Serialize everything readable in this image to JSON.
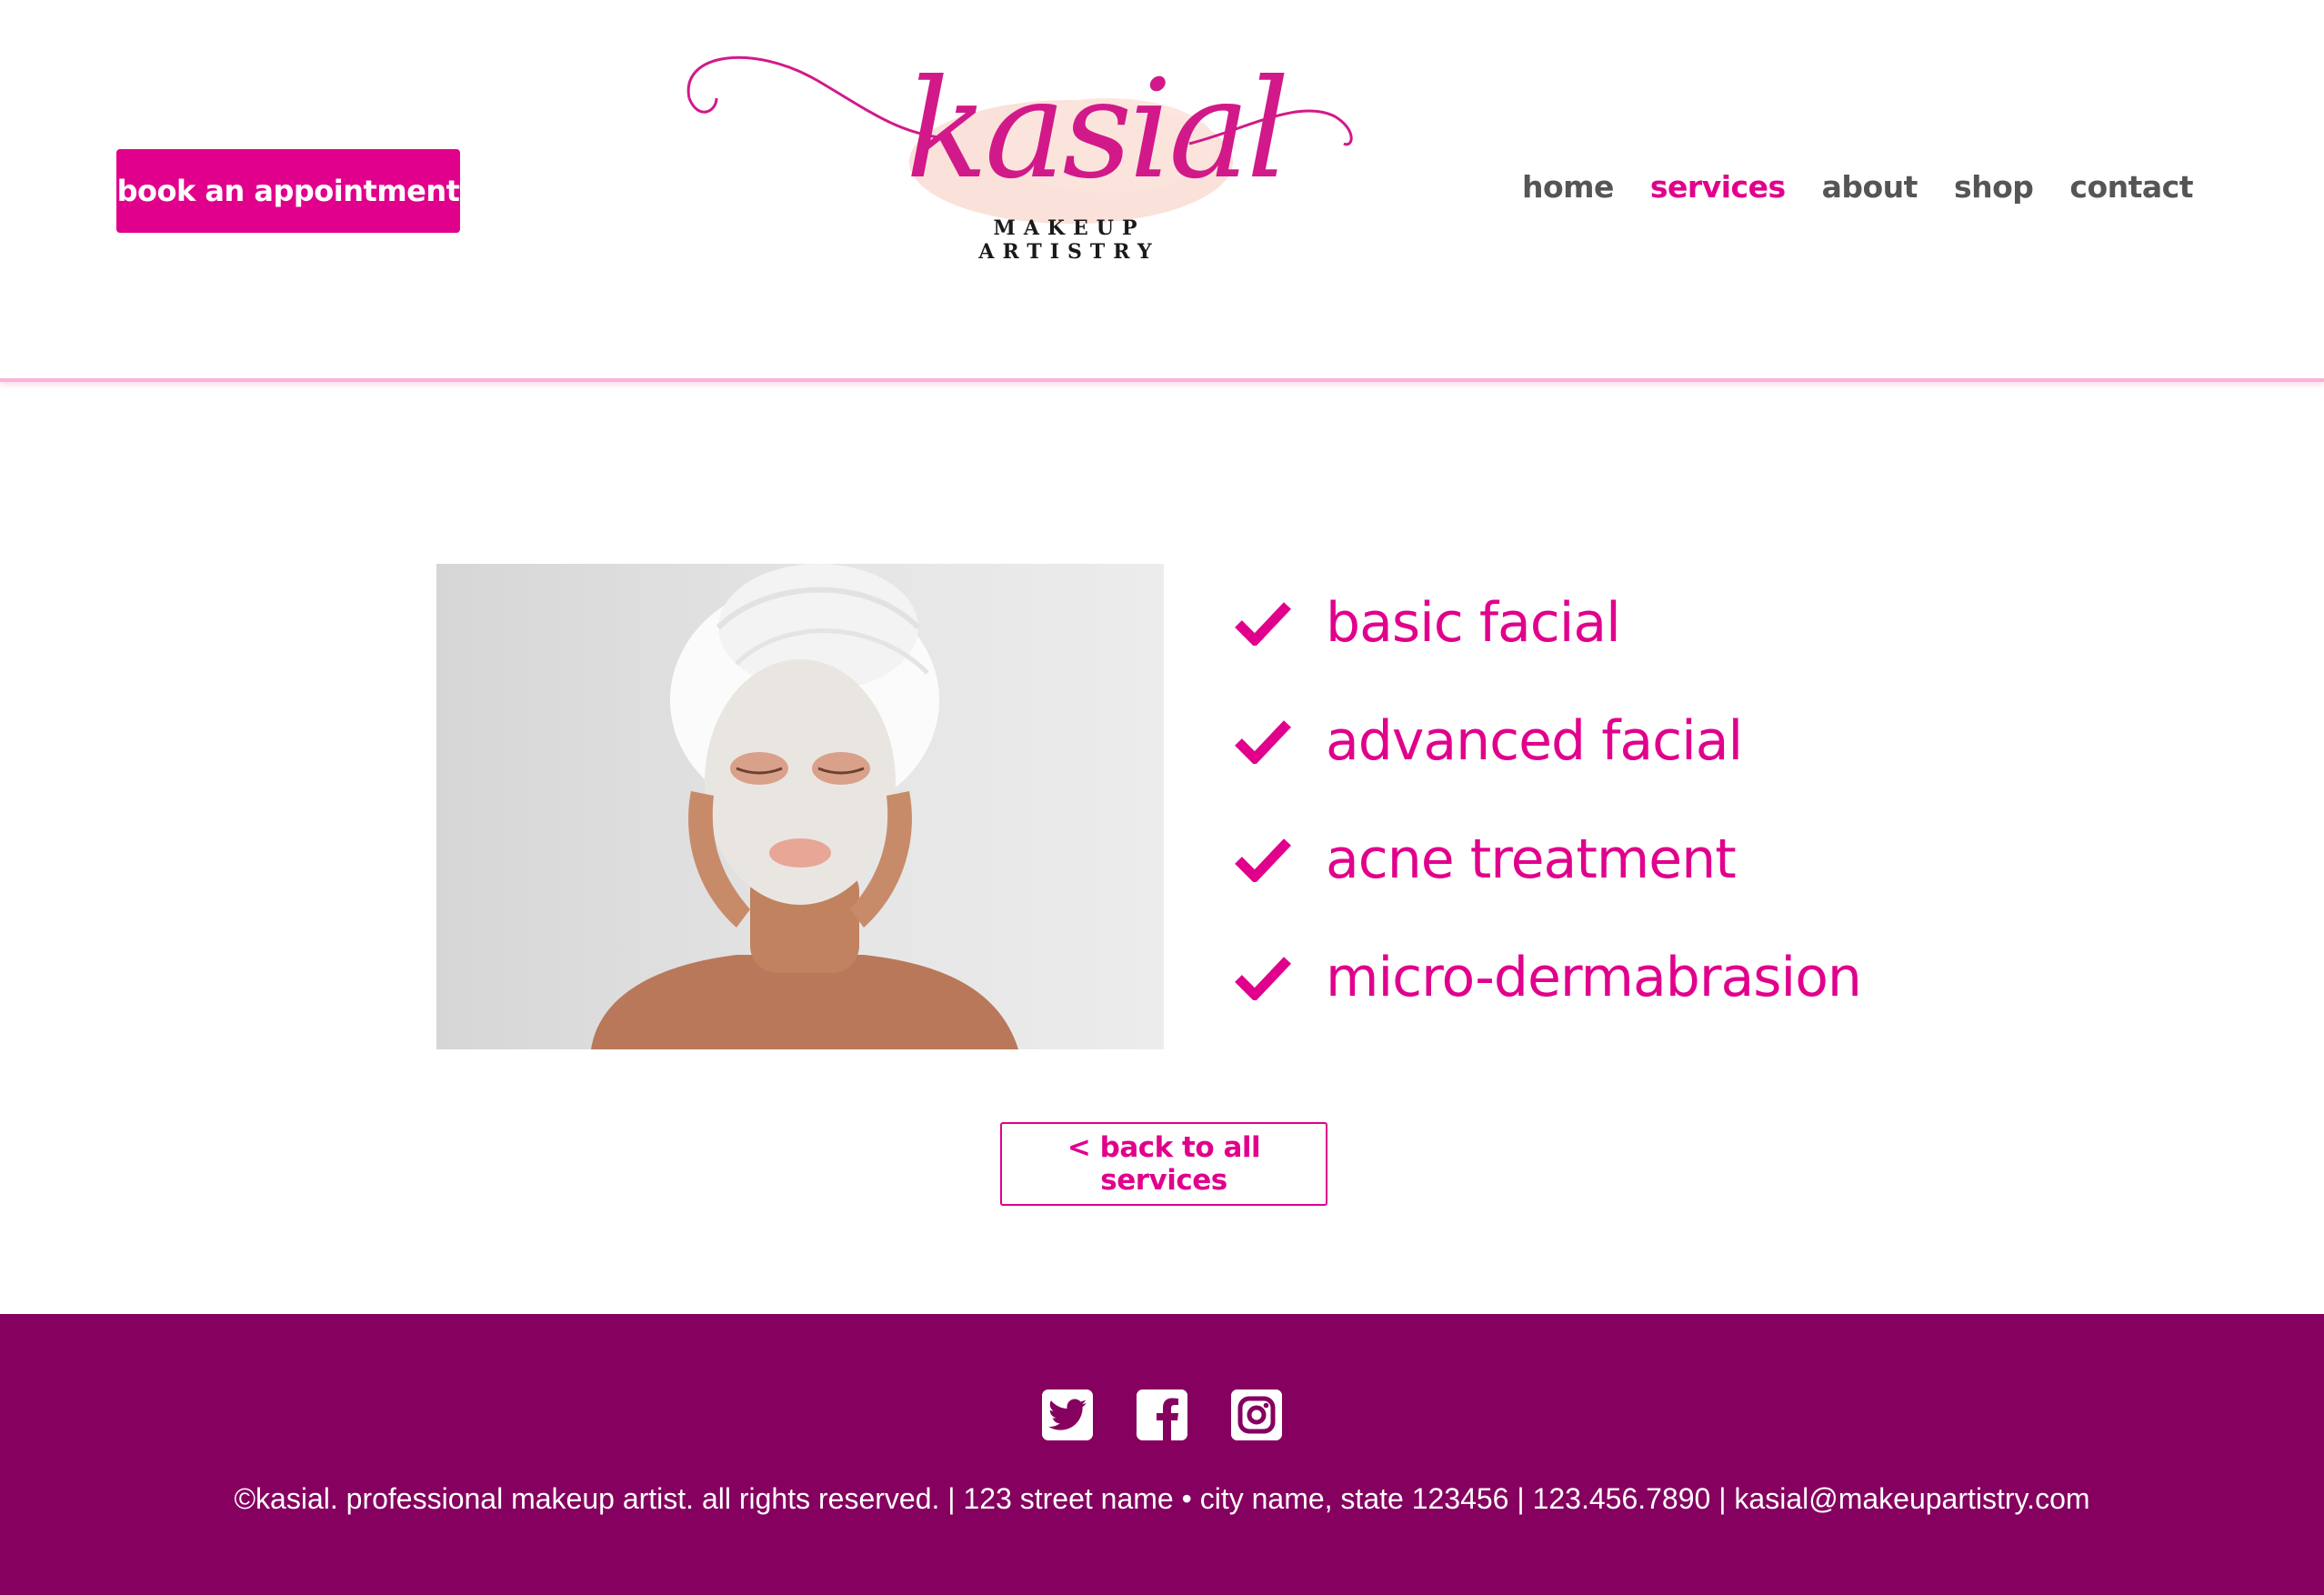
{
  "header": {
    "book_button": "book an appointment",
    "logo": {
      "wordmark": "kasial",
      "tagline": "MAKEUP ARTISTRY"
    },
    "nav": [
      {
        "label": "home",
        "active": false
      },
      {
        "label": "services",
        "active": true
      },
      {
        "label": "about",
        "active": false
      },
      {
        "label": "shop",
        "active": false
      },
      {
        "label": "contact",
        "active": false
      }
    ]
  },
  "main": {
    "photo": {
      "icon": "woman-with-facial-mask-photo"
    },
    "services": [
      "basic facial",
      "advanced facial",
      "acne treatment",
      "micro-dermabrasion"
    ],
    "back_button": "< back to all services"
  },
  "footer": {
    "social": [
      "twitter-icon",
      "facebook-icon",
      "instagram-icon"
    ],
    "text": "©kasial. professional makeup artist. all rights reserved. | 123 street name • city name, state 123456 | 123.456.7890 | kasial@makeupartistry.com"
  },
  "colors": {
    "accent": "#e1008c",
    "footer_bg": "#85005f",
    "nav_text": "#555555",
    "divider": "#f7b3d8"
  }
}
